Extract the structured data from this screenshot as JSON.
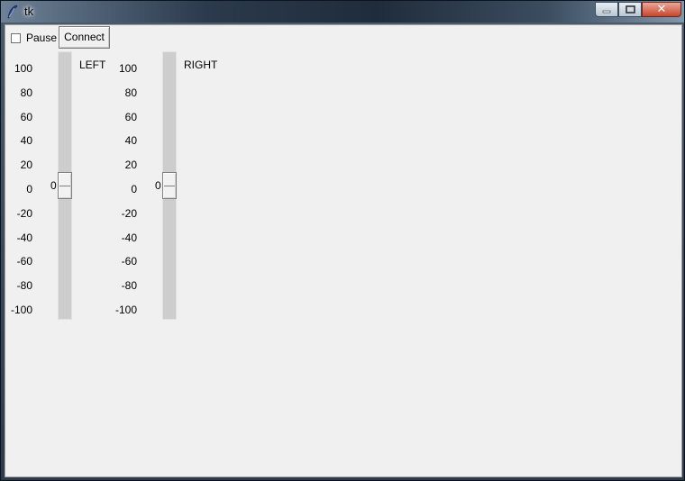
{
  "window": {
    "title": "tk"
  },
  "controls": {
    "pause_label": "Pause",
    "pause_checked": false,
    "connect_label": "Connect"
  },
  "scale_ticks": [
    "100",
    "80",
    "60",
    "40",
    "20",
    "0",
    "-20",
    "-40",
    "-60",
    "-80",
    "-100"
  ],
  "left_scale": {
    "label": "LEFT",
    "value": "0",
    "from": 100,
    "to": -100
  },
  "right_scale": {
    "label": "RIGHT",
    "value": "0",
    "from": 100,
    "to": -100
  },
  "icons": {
    "app": "feather-icon",
    "minimize": "minimize-icon",
    "maximize": "maximize-icon",
    "close": "close-icon"
  }
}
